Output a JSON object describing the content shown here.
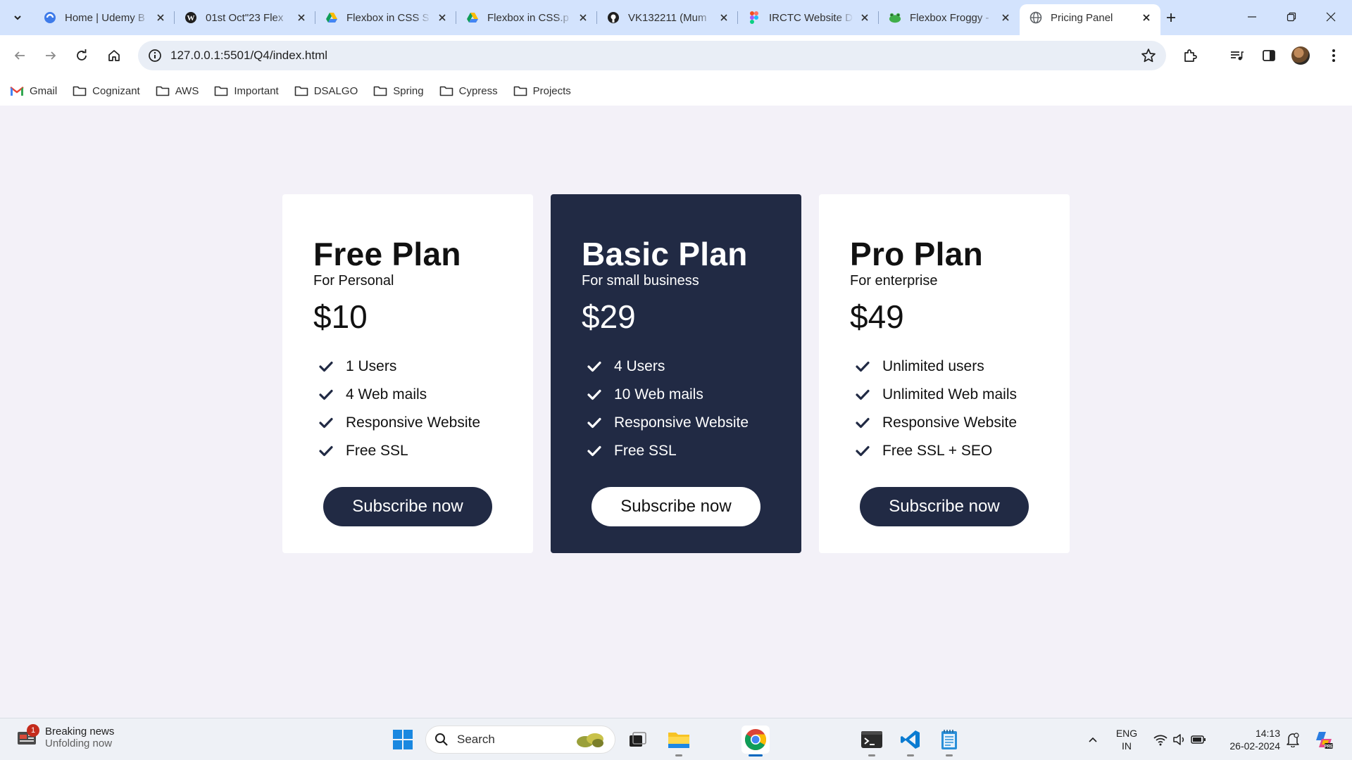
{
  "browser": {
    "tabs": [
      {
        "title": "Home | Udemy B",
        "icon": "udemy-globe-icon"
      },
      {
        "title": "01st Oct\"23 Flex",
        "icon": "wordpress-icon"
      },
      {
        "title": "Flexbox in CSS S",
        "icon": "google-drive-icon"
      },
      {
        "title": "Flexbox in CSS.p",
        "icon": "google-drive-icon"
      },
      {
        "title": "VK132211 (Mum",
        "icon": "github-icon"
      },
      {
        "title": "IRCTC Website D",
        "icon": "figma-icon"
      },
      {
        "title": "Flexbox Froggy -",
        "icon": "frog-icon"
      },
      {
        "title": "Pricing Panel",
        "icon": "globe-icon",
        "active": true
      }
    ],
    "url": "127.0.0.1:5501/Q4/index.html",
    "bookmarks": [
      "Gmail",
      "Cognizant",
      "AWS",
      "Important",
      "DSALGO",
      "Spring",
      "Cypress",
      "Projects"
    ]
  },
  "colors": {
    "navy": "#212a44",
    "page_bg": "#f3f1f8",
    "card_bg": "#ffffff"
  },
  "plans": [
    {
      "name": "Free Plan",
      "subtitle": "For Personal",
      "price": "$10",
      "features": [
        "1 Users",
        "4 Web mails",
        "Responsive Website",
        "Free SSL"
      ],
      "button": "Subscribe now",
      "theme": "light"
    },
    {
      "name": "Basic Plan",
      "subtitle": "For small business",
      "price": "$29",
      "features": [
        "4 Users",
        "10 Web mails",
        "Responsive Website",
        "Free SSL"
      ],
      "button": "Subscribe now",
      "theme": "dark"
    },
    {
      "name": "Pro Plan",
      "subtitle": "For enterprise",
      "price": "$49",
      "features": [
        "Unlimited users",
        "Unlimited Web mails",
        "Responsive Website",
        "Free SSL + SEO"
      ],
      "button": "Subscribe now",
      "theme": "light"
    }
  ],
  "taskbar": {
    "news_badge": "1",
    "news_title": "Breaking news",
    "news_subtitle": "Unfolding now",
    "search_placeholder": "Search",
    "lang_line1": "ENG",
    "lang_line2": "IN",
    "time": "14:13",
    "date": "26-02-2024"
  }
}
